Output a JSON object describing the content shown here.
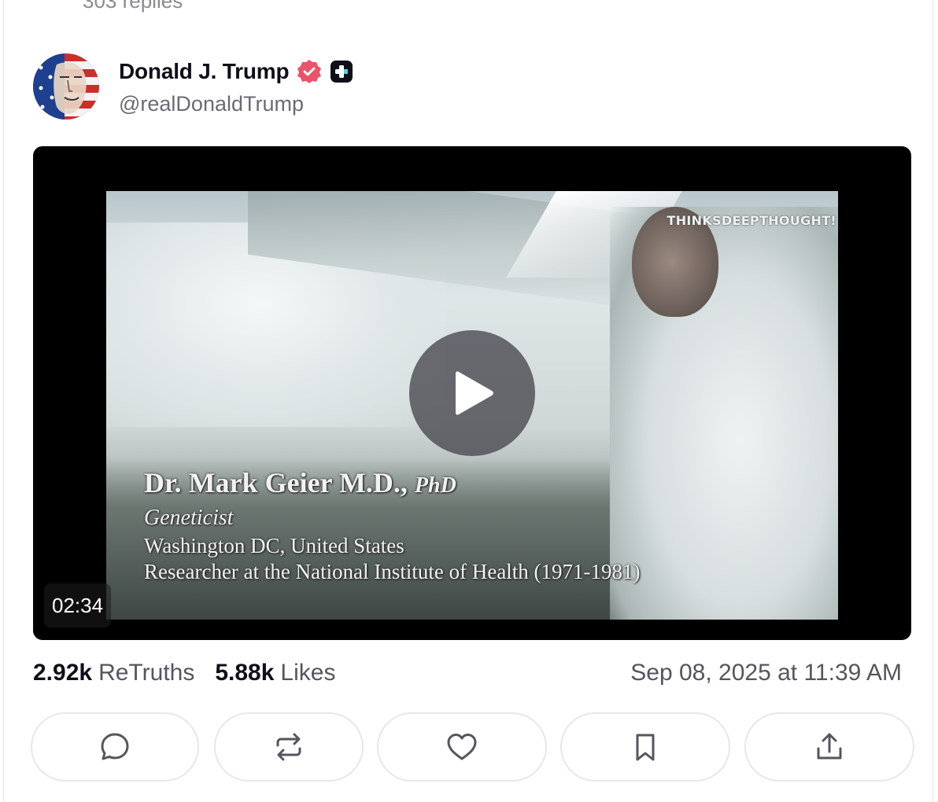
{
  "previous": {
    "replies_text": "303 replies"
  },
  "post": {
    "author": {
      "name": "Donald J. Trump",
      "handle": "@realDonaldTrump",
      "verified": true,
      "avatar_icon": "flag-portrait-avatar",
      "badge_icon": "plus-badge-icon"
    },
    "video": {
      "duration": "02:34",
      "watermark": "THINKSDEEPTHOUGHT!",
      "caption": {
        "line1": "Dr. Mark Geier M.D.,",
        "line1_suffix": "PhD",
        "line2": "Geneticist",
        "line3": "Washington DC, United States",
        "line4": "Researcher at the National Institute of Health (1971-1981)"
      }
    },
    "stats": {
      "retruths_value": "2.92k",
      "retruths_label": "ReTruths",
      "likes_value": "5.88k",
      "likes_label": "Likes"
    },
    "timestamp": "Sep 08, 2025 at 11:39 AM",
    "actions": {
      "reply_icon": "reply-icon",
      "retruth_icon": "retruth-icon",
      "like_icon": "heart-icon",
      "bookmark_icon": "bookmark-icon",
      "share_icon": "share-icon"
    }
  },
  "colors": {
    "verified_badge": "#e8546a",
    "text_primary": "#0f0f1a",
    "text_secondary": "#55555f",
    "button_border": "#e7e7ec"
  }
}
